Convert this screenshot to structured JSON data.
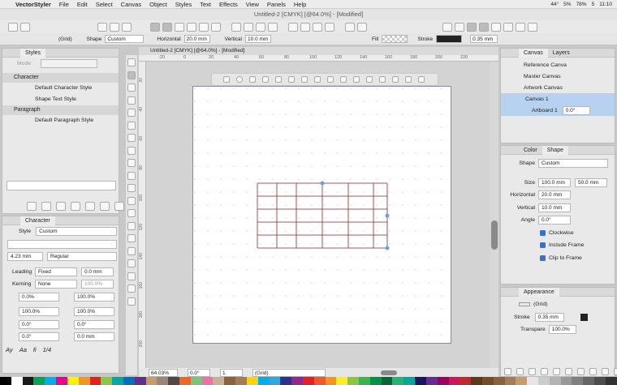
{
  "menubar": {
    "app": "VectorStyler",
    "items": [
      "File",
      "Edit",
      "Select",
      "Canvas",
      "Object",
      "Styles",
      "Text",
      "Effects",
      "View",
      "Panels",
      "Help"
    ],
    "status": [
      "44°",
      "5%",
      "78%",
      "5",
      "11:10"
    ]
  },
  "window": {
    "title": "Untitled-2 [CMYK] [@64.0%] - [Modified]"
  },
  "doc_tab": {
    "label": "Untitled-2 [CMYK] [@64.0%] - [Modified]"
  },
  "propbar": {
    "object": "(Grid)",
    "shape_label": "Shape",
    "shape_value": "Custom",
    "h_label": "Horizontal",
    "h_value": "20.0 mm",
    "v_label": "Vertical",
    "v_value": "10.0 mm",
    "fill_label": "Fill",
    "stroke_label": "Stroke",
    "stroke_value": "0.35 mm"
  },
  "styles_panel": {
    "title": "Styles",
    "mode_label": "Mode",
    "groups": [
      {
        "name": "Character",
        "items": [
          "Default Character Style",
          "Shape Text Style"
        ]
      },
      {
        "name": "Paragraph",
        "items": [
          "Default Paragraph Style"
        ]
      }
    ]
  },
  "character_panel": {
    "title": "Character",
    "style_label": "Style",
    "style_value": "Custom",
    "size": "4.23 mm",
    "weight": "Regular",
    "leading_label": "Leading",
    "leading_mode": "Fixed",
    "leading_value": "0.0 mm",
    "kerning_label": "Kerning",
    "kerning_mode": "None",
    "kerning_value": "100.0%",
    "hscale": "0.0%",
    "vscale": "100.0%",
    "sx": "100.0%",
    "sy": "100.0%",
    "rot1": "0.0°",
    "rot2": "0.0°",
    "baseline": "0.0°",
    "shift": "0.0 mm",
    "bottom_glyphs": [
      "Ay",
      "Aa",
      "fi",
      "1/4"
    ]
  },
  "canvas_panel": {
    "tabs": [
      "Canvas",
      "Layers"
    ],
    "tree": [
      {
        "label": "Reference Canva"
      },
      {
        "label": "Master Canvas"
      },
      {
        "label": "Artwork Canvas"
      },
      {
        "label": "Canvas 1"
      },
      {
        "label": "Artboard 1",
        "value": "0.0°"
      }
    ]
  },
  "shape_panel": {
    "tabs": [
      "Color",
      "Shape"
    ],
    "shape_label": "Shape",
    "shape_value": "Custom",
    "size_label": "Size",
    "width": "100.0 mm",
    "height": "50.0 mm",
    "h_label": "Horizontal",
    "h_value": "20.0 mm",
    "v_label": "Vertical",
    "v_value": "10.0 mm",
    "angle_label": "Angle",
    "angle_value": "0.0°",
    "checks": [
      "Clockwise",
      "Include Frame",
      "Clip to Frame"
    ]
  },
  "appearance_panel": {
    "title": "Appearance",
    "object": "(Grid)",
    "stroke_label": "Stroke",
    "stroke_value": "0.35 mm",
    "transp_label": "Transpare",
    "transp_value": "100.0%"
  },
  "statusbar": {
    "zoom": "64.03%",
    "angle": "0.0°",
    "page": "1",
    "object": "(Grid)"
  },
  "ruler": {
    "h_ticks": [
      "-20",
      "0",
      "20",
      "40",
      "60",
      "80",
      "100",
      "120",
      "140",
      "160",
      "180",
      "200",
      "220"
    ],
    "v_ticks": [
      "20",
      "40",
      "60",
      "80",
      "100",
      "120",
      "140",
      "160",
      "180",
      "200"
    ]
  },
  "colors": {
    "grid_stroke": "#7a2a2a",
    "accent": "#2b74d9"
  },
  "swatches": [
    "#000000",
    "#ffffff",
    "#1a1a1a",
    "#00a651",
    "#00aeef",
    "#ec008c",
    "#fff200",
    "#f7941d",
    "#ed1c24",
    "#8dc63f",
    "#00a99d",
    "#0072bc",
    "#662d91",
    "#c69c6d",
    "#998675",
    "#534741",
    "#f26522",
    "#7cc576",
    "#f06eaa",
    "#c7b299",
    "#8c6239",
    "#a67c52",
    "#ffd400",
    "#00adef",
    "#29abe2",
    "#2e3192",
    "#92278f",
    "#ec1c24",
    "#f15a24",
    "#f7931e",
    "#fcee21",
    "#8cc63e",
    "#39b54a",
    "#009245",
    "#006837",
    "#22b573",
    "#00a99d",
    "#1b1464",
    "#662d91",
    "#9e005d",
    "#d4145a",
    "#c1272d",
    "#603813",
    "#754c24",
    "#8c6239",
    "#a67c52",
    "#c69c6d",
    "#e6e6e6",
    "#cccccc",
    "#b3b3b3",
    "#999999",
    "#808080",
    "#666666",
    "#4d4d4d",
    "#333333"
  ]
}
